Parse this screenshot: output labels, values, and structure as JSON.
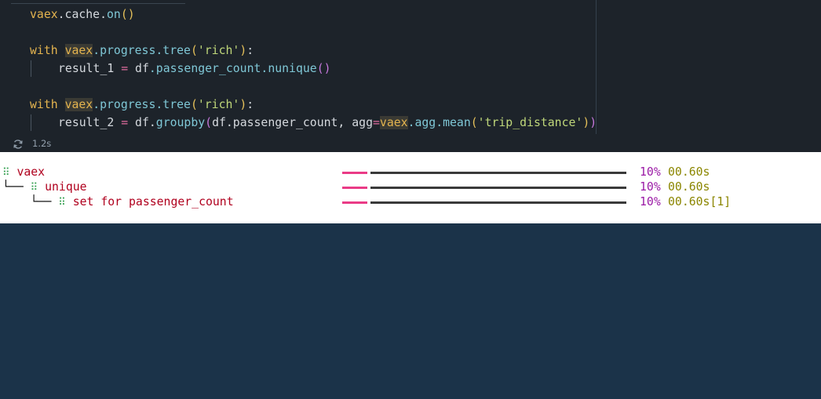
{
  "code": {
    "line1": {
      "obj": "vaex",
      "rest": ".cache.",
      "fn": "on",
      "args": "()"
    },
    "line2": {
      "kw": "with",
      "obj": "vaex",
      "attr": ".progress.",
      "fn": "tree",
      "open": "(",
      "arg": "'rich'",
      "close": ")",
      "colon": ":"
    },
    "line3": {
      "lhs": "result_1",
      "eq": "=",
      "obj": "df",
      "rest": ".passenger_count.",
      "fn": "nunique",
      "args": "()"
    },
    "line4": {
      "kw": "with",
      "obj": "vaex",
      "attr": ".progress.",
      "fn": "tree",
      "open": "(",
      "arg": "'rich'",
      "close": ")",
      "colon": ":"
    },
    "line5": {
      "lhs": "result_2",
      "eq": "=",
      "obj": "df",
      "dot": ".",
      "fn": "groupby",
      "open": "(",
      "arg1": "df.passenger_count,",
      "kwarg": "agg",
      "eq2": "=",
      "obj2": "vaex",
      "rest2": ".agg.",
      "fn2": "mean",
      "open2": "(",
      "arg2": "'trip_distance'",
      "close2": ")",
      "close": ")"
    }
  },
  "execution": {
    "icon": "refresh-icon",
    "time": "1.2s"
  },
  "progress": [
    {
      "prefix": "",
      "spinner": "⠿",
      "name": "vaex",
      "percent": "10%",
      "time": "00.60s",
      "fraction": 0.1
    },
    {
      "prefix": "└──",
      "spinner": "⠿",
      "name": "unique",
      "percent": "10%",
      "time": "00.60s",
      "fraction": 0.1
    },
    {
      "prefix": "    └──",
      "spinner": "⠿",
      "name": "set for passenger_count",
      "percent": "10%",
      "time": "00.60s[1]",
      "fraction": 0.1
    }
  ],
  "colors": {
    "pink": "#ea3b86",
    "bar": "#3a3a3a",
    "percent": "#9b1aa6",
    "time": "#8b8600",
    "name": "#b0001e"
  }
}
